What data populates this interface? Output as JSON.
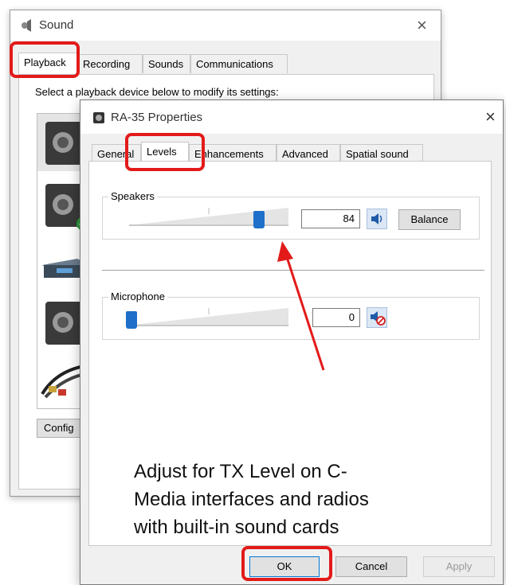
{
  "sound_window": {
    "title": "Sound",
    "tabs": [
      "Playback",
      "Recording",
      "Sounds",
      "Communications"
    ],
    "instruction": "Select a playback device below to modify its settings:",
    "configure_label": "Config"
  },
  "props_window": {
    "title": "RA-35 Properties",
    "tabs": [
      "General",
      "Levels",
      "Enhancements",
      "Advanced",
      "Spatial sound"
    ],
    "active_tab": "Levels",
    "speakers": {
      "label": "Speakers",
      "value": "84",
      "level_percent": 84,
      "balance_label": "Balance"
    },
    "microphone": {
      "label": "Microphone",
      "value": "0",
      "level_percent": 0
    },
    "buttons": {
      "ok": "OK",
      "cancel": "Cancel",
      "apply": "Apply"
    }
  },
  "annotation": {
    "lines": [
      "Adjust for TX Level on C-",
      "Media interfaces and radios",
      "with built-in sound cards"
    ]
  },
  "colors": {
    "highlight": "#e31a1a",
    "thumb": "#1e6fc9",
    "arrow": "#e31a1a"
  }
}
